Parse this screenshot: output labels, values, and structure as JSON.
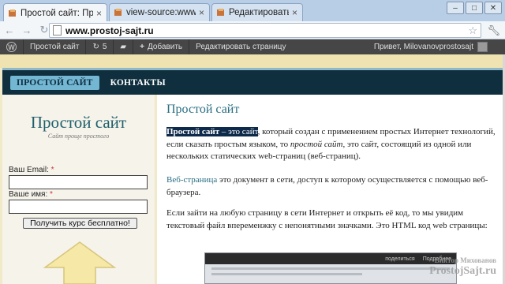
{
  "browser": {
    "tabs": [
      {
        "title": "Простой сайт: Прос",
        "active": true
      },
      {
        "title": "view-source:www.pr",
        "active": false
      },
      {
        "title": "Редактировать тем",
        "active": false
      }
    ],
    "url": "www.prostoj-sajt.ru",
    "window_buttons": [
      "–",
      "□",
      "✕"
    ]
  },
  "adminbar": {
    "site_name": "Простой сайт",
    "updates_count": "5",
    "add_new": "Добавить",
    "edit_page": "Редактировать страницу",
    "greeting": "Привет, Milovanovprostosajt"
  },
  "site": {
    "menu": [
      "ПРОСТОЙ САЙТ",
      "КОНТАКТЫ"
    ],
    "title": "Простой сайт",
    "tagline": "Сайт проще простого"
  },
  "form": {
    "email_label": "Ваш Email:",
    "name_label": "Ваше имя:",
    "required_mark": "*",
    "submit": "Получить курс бесплатно!"
  },
  "post": {
    "title": "Простой сайт",
    "p1_term": "Простой сайт",
    "p1_dash": " – это сайт",
    "p1_rest_a": ", который создан с применением простых Интернет технологий, если сказать простым языком, то ",
    "p1_em": "простой сайт",
    "p1_rest_b": ", это сайт, состоящий из одной или нескольких статических web-страниц (веб-страниц).",
    "p2_link": "Веб-страница",
    "p2_rest": " это документ в сети, доступ к которому осуществляется с помощью веб-браузера.",
    "p3": "Если зайти на любую страницу в сети Интернет и открыть  её код, то мы увидим текстовый файл впеременжку с непонятными значками. Это HTML код web страницы:",
    "embed_share": "поделиться",
    "embed_more": "Подробнее"
  },
  "watermark": {
    "author": "Виктор Михованов",
    "site": "ProstojSajt.ru"
  }
}
